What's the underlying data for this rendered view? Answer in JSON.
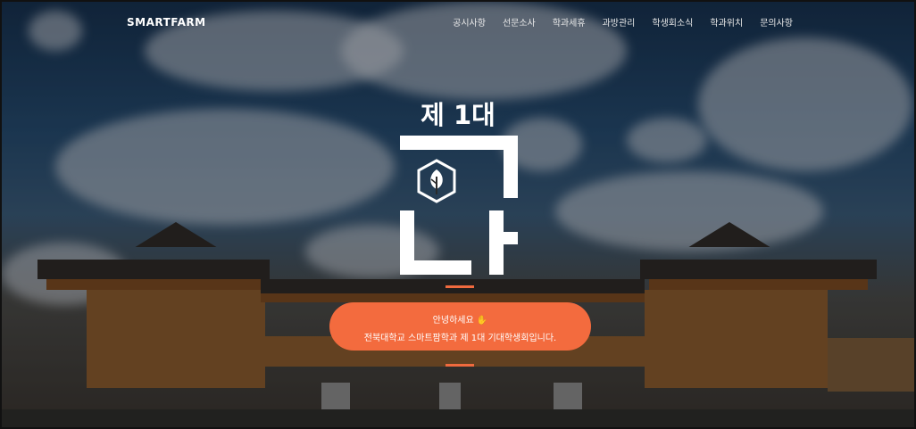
{
  "brand": "SMARTFARM",
  "nav_items": [
    "공시사항",
    "선문소사",
    "학과세휴",
    "과방관리",
    "학생회소식",
    "학과위치",
    "문의사항"
  ],
  "hero": {
    "subtitle": "제 1대",
    "greeting": "안녕하세요",
    "hand_icon": "hand-wave-icon",
    "message": "전북대학교 스마트팜학과 제 1대 기대학생회입니다."
  },
  "colors": {
    "accent": "#f36b3e",
    "text": "#ffffff"
  }
}
